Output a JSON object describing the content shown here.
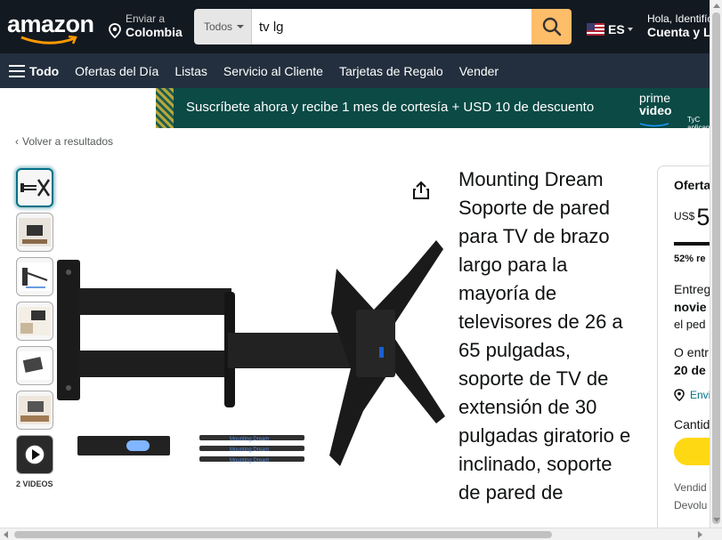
{
  "header": {
    "logo_text": "amazon",
    "deliver_line1": "Enviar a",
    "deliver_line2": "Colombia",
    "search_category": "Todos",
    "search_value": "tv lg",
    "language": "ES",
    "account_line1": "Hola, Identifícate",
    "account_line2": "Cuenta y Listas"
  },
  "nav": {
    "all_label": "Todo",
    "items": [
      "Ofertas del Día",
      "Listas",
      "Servicio al Cliente",
      "Tarjetas de Regalo",
      "Vender"
    ]
  },
  "banner": {
    "text": "Suscríbete ahora y recibe 1 mes de cortesía + USD 10 de descuento",
    "prime_line1": "prime",
    "prime_line2": "video",
    "tyc": "TyC aplican"
  },
  "back_link": "Volver a resultados",
  "gallery": {
    "videos_label": "2 VIDEOS",
    "watermark": "Mounting Dream"
  },
  "product": {
    "title": "Mounting Dream Soporte de pared para TV de brazo largo para la mayoría de televisores de 26 a 65 pulgadas, soporte de TV de extensión de 30 pulgadas giratorio e inclinado, soporte de pared de"
  },
  "buybox": {
    "oferta": "Oferta",
    "currency": "US$",
    "price_digit": "5",
    "percent": "52% re",
    "entrega_l1": "Entreg",
    "entrega_l2": "novie",
    "entrega_l3": "el ped",
    "o_l1": "O entr",
    "o_l2": "20 de",
    "enviar": "Envi",
    "cantidad": "Cantid",
    "vendido_l1": "Vendid",
    "vendido_l2": "Devolu"
  }
}
